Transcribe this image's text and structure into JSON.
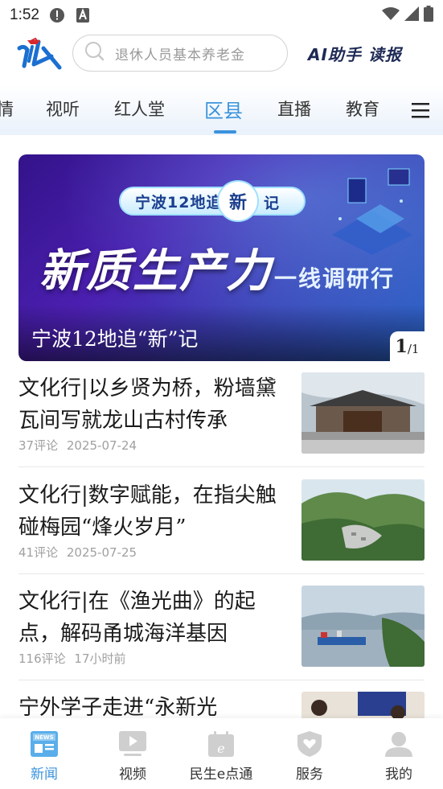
{
  "status_bar": {
    "time": "1:52",
    "icons": [
      "notification-alert-icon",
      "text-a-icon",
      "wifi-icon",
      "signal-icon",
      "battery-icon"
    ]
  },
  "header": {
    "logo_name": "app-logo",
    "search_placeholder": "退休人员基本养老金",
    "ai_button_label": "AI助手 读报"
  },
  "tabs": [
    {
      "label": "情",
      "active": false
    },
    {
      "label": "视听",
      "active": false
    },
    {
      "label": "红人堂",
      "active": false
    },
    {
      "label": "区县",
      "active": true
    },
    {
      "label": "直播",
      "active": false
    },
    {
      "label": "教育",
      "active": false
    }
  ],
  "banner": {
    "pill_left": "宁波12地追",
    "pill_circle": "新",
    "pill_tail": "记",
    "big_text": "新质生产力",
    "sub_text": "一线调研行",
    "caption": "宁波12地追“新”记",
    "counter_current": "1",
    "counter_total": "/1"
  },
  "news": [
    {
      "title": "文化行|以乡贤为桥，粉墙黛瓦间写就龙山古村传承",
      "comments": "37评论",
      "time": "2025-07-24",
      "thumb": "ancestral-hall-photo"
    },
    {
      "title": "文化行|数字赋能，在指尖触碰梅园“烽火岁月”",
      "comments": "41评论",
      "time": "2025-07-25",
      "thumb": "mountain-village-photo"
    },
    {
      "title": "文化行|在《渔光曲》的起点，解码甬城海洋基因",
      "comments": "116评论",
      "time": "17小时前",
      "thumb": "fishing-harbor-photo"
    },
    {
      "title": "宁外学子走进“永新光",
      "comments": "",
      "time": "",
      "thumb": "students-photo"
    }
  ],
  "bottom_nav": [
    {
      "label": "新闻",
      "icon": "news-icon",
      "active": true
    },
    {
      "label": "视频",
      "icon": "video-icon",
      "active": false
    },
    {
      "label": "民生e点通",
      "icon": "calendar-e-icon",
      "active": false
    },
    {
      "label": "服务",
      "icon": "shield-heart-icon",
      "active": false
    },
    {
      "label": "我的",
      "icon": "user-icon",
      "active": false
    }
  ],
  "colors": {
    "accent": "#3a93dc",
    "text": "#1a1a1a",
    "meta": "#a0a0a0"
  }
}
